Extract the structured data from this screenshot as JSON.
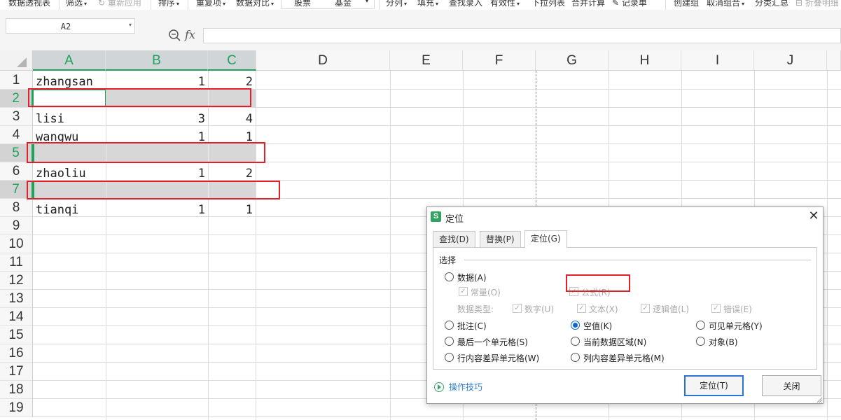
{
  "toolbar": {
    "items": [
      {
        "label": "数据透视表",
        "caret": false,
        "disabled": false
      },
      {
        "label": "筛选",
        "caret": true,
        "disabled": false
      },
      {
        "label": "重新应用",
        "caret": false,
        "disabled": true
      },
      {
        "label": "排序",
        "caret": true,
        "disabled": false
      },
      {
        "label": "重复项",
        "caret": true,
        "disabled": false
      },
      {
        "label": "数据对比",
        "caret": true,
        "disabled": false
      },
      {
        "label": "分列",
        "caret": true,
        "disabled": false
      },
      {
        "label": "填充",
        "caret": true,
        "disabled": false
      },
      {
        "label": "查找录入",
        "caret": false,
        "disabled": false
      },
      {
        "label": "有效性",
        "caret": true,
        "disabled": false
      },
      {
        "label": "下拉列表",
        "caret": false,
        "disabled": false
      },
      {
        "label": "合并计算",
        "caret": false,
        "disabled": false
      },
      {
        "label": "记录单",
        "caret": false,
        "disabled": false
      },
      {
        "label": "创建组",
        "caret": false,
        "disabled": false
      },
      {
        "label": "取消组合",
        "caret": true,
        "disabled": false
      },
      {
        "label": "分类汇总",
        "caret": false,
        "disabled": false
      },
      {
        "label": "折叠明细",
        "caret": false,
        "disabled": true
      }
    ],
    "combo_options": [
      "股票",
      "基金"
    ]
  },
  "formula_bar": {
    "name_box_value": "A2",
    "fx_label": "fx",
    "formula_value": ""
  },
  "sheet": {
    "columns": [
      "A",
      "B",
      "C",
      "D",
      "E",
      "F",
      "G",
      "H",
      "I",
      "J"
    ],
    "selected_columns": [
      "A",
      "B",
      "C"
    ],
    "rows": [
      "1",
      "2",
      "3",
      "4",
      "5",
      "6",
      "7",
      "8",
      "9",
      "10",
      "11",
      "12",
      "13",
      "14",
      "15",
      "16",
      "17",
      "18",
      "19"
    ],
    "selected_rows": [
      "2",
      "5",
      "7"
    ],
    "active_cell": "A2",
    "cells": [
      {
        "ref": "A1",
        "value": "zhangsan"
      },
      {
        "ref": "B1",
        "value": "1"
      },
      {
        "ref": "C1",
        "value": "2"
      },
      {
        "ref": "A3",
        "value": "lisi"
      },
      {
        "ref": "B3",
        "value": "3"
      },
      {
        "ref": "C3",
        "value": "4"
      },
      {
        "ref": "A4",
        "value": "wangwu"
      },
      {
        "ref": "B4",
        "value": "1"
      },
      {
        "ref": "C4",
        "value": "1"
      },
      {
        "ref": "A6",
        "value": "zhaoliu"
      },
      {
        "ref": "B6",
        "value": "1"
      },
      {
        "ref": "C6",
        "value": "2"
      },
      {
        "ref": "A8",
        "value": "tianqi"
      },
      {
        "ref": "B8",
        "value": "1"
      },
      {
        "ref": "C8",
        "value": "1"
      }
    ],
    "highlight_color": "#e0202c",
    "selection_accent": "#1fa25c"
  },
  "dialog": {
    "title": "定位",
    "logo_letter": "S",
    "close_glyph": "✕",
    "tabs": [
      {
        "label": "查找(D)",
        "active": false
      },
      {
        "label": "替换(P)",
        "active": false
      },
      {
        "label": "定位(G)",
        "active": true
      }
    ],
    "group_label": "选择",
    "radios": [
      {
        "label": "数据(A)",
        "checked": false
      },
      {
        "label": "批注(C)",
        "checked": false
      },
      {
        "label": "空值(K)",
        "checked": true
      },
      {
        "label": "可见单元格(Y)",
        "checked": false
      },
      {
        "label": "最后一个单元格(S)",
        "checked": false
      },
      {
        "label": "当前数据区域(N)",
        "checked": false
      },
      {
        "label": "对象(B)",
        "checked": false
      },
      {
        "label": "行内容差异单元格(W)",
        "checked": false
      },
      {
        "label": "列内容差异单元格(M)",
        "checked": false
      }
    ],
    "sub_checks": [
      {
        "label": "常量(O)",
        "checked": true
      },
      {
        "label": "公式(R)",
        "checked": true
      }
    ],
    "data_type_label": "数据类型:",
    "data_types": [
      {
        "label": "数字(U)",
        "checked": true
      },
      {
        "label": "文本(X)",
        "checked": true
      },
      {
        "label": "逻辑值(L)",
        "checked": true
      },
      {
        "label": "错误(E)",
        "checked": true
      }
    ],
    "tips_link": "操作技巧",
    "ok_button": "定位(T)",
    "close_button": "关闭"
  }
}
